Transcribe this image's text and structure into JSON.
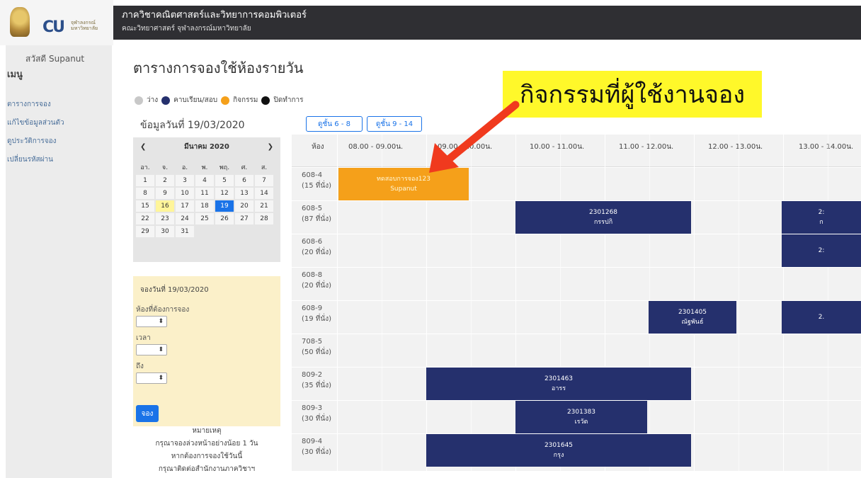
{
  "header": {
    "department": "ภาควิชาคณิตศาสตร์และวิทยาการคอมพิวเตอร์",
    "faculty": "คณะวิทยาศาสตร์ จุฬาลงกรณ์มหาวิทยาลัย",
    "logo_text": "จุฬาลงกรณ์ มหาวิทยาลัย",
    "logo_letters": "CU"
  },
  "sidebar": {
    "greeting": "สวัสดี Supanut",
    "menu_title": "เมนู",
    "items": [
      {
        "label": "ตารางการจอง"
      },
      {
        "label": "แก้ไขข้อมูลส่วนตัว"
      },
      {
        "label": "ดูประวัติการจอง"
      },
      {
        "label": "เปลี่ยนรหัสผ่าน"
      }
    ]
  },
  "page": {
    "title": "ตารางการจองใช้ห้องรายวัน",
    "date_info": "ข้อมูลวันที่ 19/03/2020",
    "floor_buttons": [
      "ดูชั้น 6 - 8",
      "ดูชั้น 9 - 14"
    ]
  },
  "legend": [
    {
      "label": "ว่าง",
      "color": "#c8c8c8"
    },
    {
      "label": "คาบเรียน/สอบ",
      "color": "#25306d"
    },
    {
      "label": "กิจกรรม",
      "color": "#f5a01a"
    },
    {
      "label": "ปิดทำการ",
      "color": "#111111"
    }
  ],
  "callout": {
    "text": "กิจกรรมที่ผู้ใช้งานจอง"
  },
  "calendar": {
    "month_label": "มีนาคม 2020",
    "prev": "❮",
    "next": "❯",
    "weekdays": [
      "อา.",
      "จ.",
      "อ.",
      "พ.",
      "พฤ.",
      "ศ.",
      "ส."
    ],
    "weeks": [
      [
        "1",
        "2",
        "3",
        "4",
        "5",
        "6",
        "7"
      ],
      [
        "8",
        "9",
        "10",
        "11",
        "12",
        "13",
        "14"
      ],
      [
        "15",
        "16",
        "17",
        "18",
        "19",
        "20",
        "21"
      ],
      [
        "22",
        "23",
        "24",
        "25",
        "26",
        "27",
        "28"
      ],
      [
        "29",
        "30",
        "31",
        "",
        "",
        "",
        ""
      ]
    ],
    "today": "16",
    "selected": "19"
  },
  "booking_form": {
    "date_label": "จองวันที่ 19/03/2020",
    "room_label": "ห้องที่ต้องการจอง",
    "time_label": "เวลา",
    "until_label": "ถึง",
    "submit": "จอง"
  },
  "note": {
    "title": "หมายเหตุ",
    "lines": [
      "กรุณาจองล่วงหน้าอย่างน้อย 1 วัน",
      "หากต้องการจองใช้วันนี้",
      "กรุณาติดต่อสำนักงานภาควิชาฯ"
    ]
  },
  "schedule": {
    "room_header": "ห้อง",
    "time_slots": [
      "08.00 - 09.00น.",
      "09.00 - 10.00น.",
      "10.00 - 11.00น.",
      "11.00 - 12.00น.",
      "12.00 - 13.00น.",
      "13.00 - 14.00น."
    ],
    "rooms": [
      {
        "name": "608-4",
        "seats": "(15 ที่นั่ง)"
      },
      {
        "name": "608-5",
        "seats": "(87 ที่นั่ง)"
      },
      {
        "name": "608-6",
        "seats": "(20 ที่นั่ง)"
      },
      {
        "name": "608-8",
        "seats": "(20 ที่นั่ง)"
      },
      {
        "name": "608-9",
        "seats": "(19 ที่นั่ง)"
      },
      {
        "name": "708-5",
        "seats": "(50 ที่นั่ง)"
      },
      {
        "name": "809-2",
        "seats": "(35 ที่นั่ง)"
      },
      {
        "name": "809-3",
        "seats": "(30 ที่นั่ง)"
      },
      {
        "name": "809-4",
        "seats": "(30 ที่นั่ง)"
      }
    ],
    "bookings": [
      {
        "room": 0,
        "type": "activity",
        "line1": "ทดสอบการจอง123",
        "line2": "Supanut"
      },
      {
        "room": 1,
        "type": "class",
        "line1": "2301268",
        "line2": "กรรปกิ"
      },
      {
        "room": 1,
        "type": "class",
        "line1": "2:",
        "line2": "ก"
      },
      {
        "room": 2,
        "type": "class",
        "line1": "2:",
        "line2": ""
      },
      {
        "room": 4,
        "type": "class",
        "line1": "2301405",
        "line2": "ณัฐพันธ์"
      },
      {
        "room": 4,
        "type": "class",
        "line1": "2.",
        "line2": ""
      },
      {
        "room": 6,
        "type": "class",
        "line1": "2301463",
        "line2": "อารร"
      },
      {
        "room": 7,
        "type": "class",
        "line1": "2301383",
        "line2": "เรวัต"
      },
      {
        "room": 8,
        "type": "class",
        "line1": "2301645",
        "line2": "กรุง"
      }
    ]
  }
}
